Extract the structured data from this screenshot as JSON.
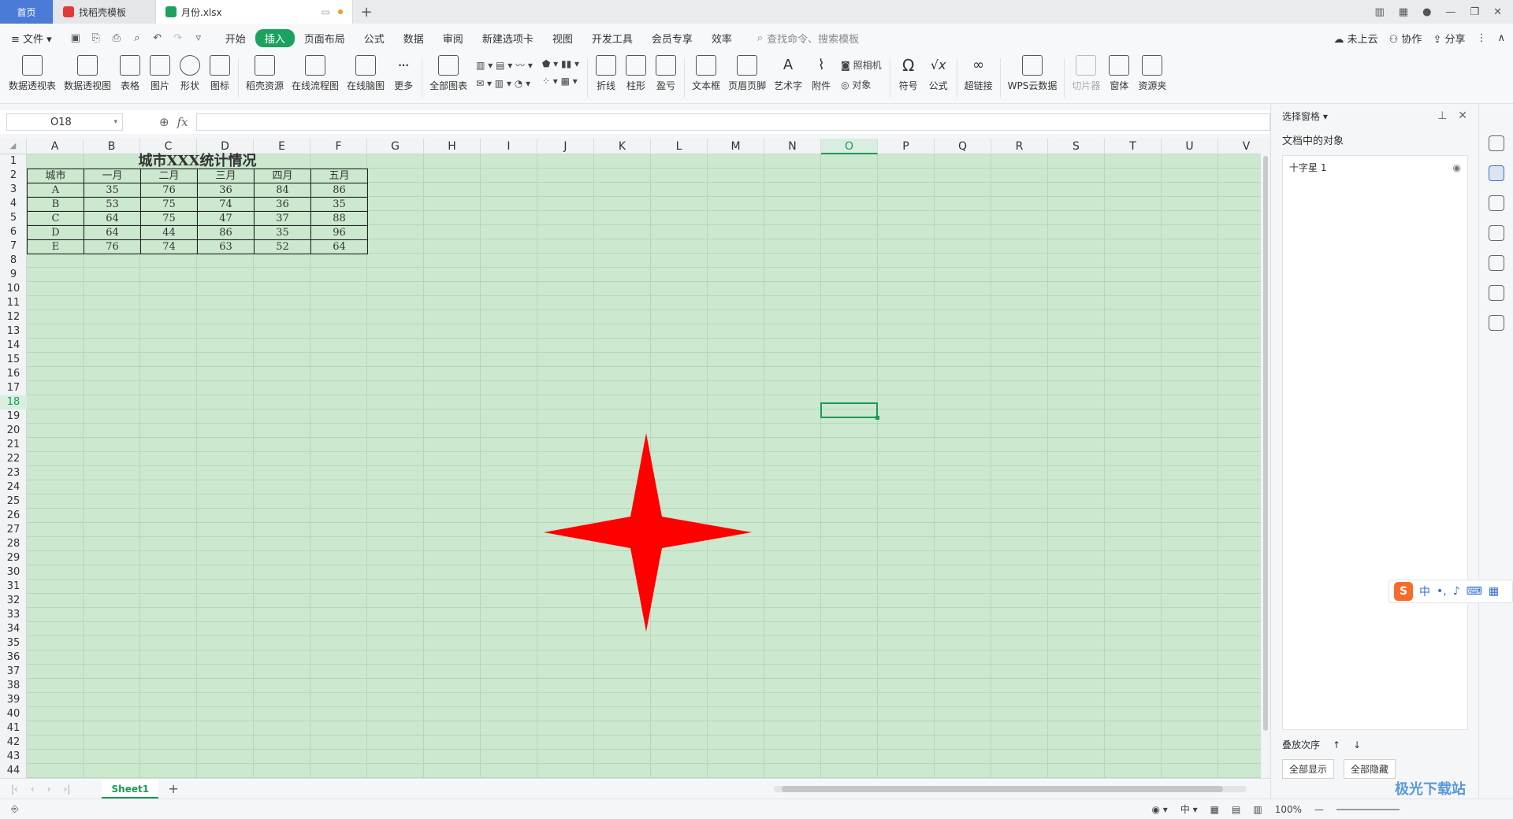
{
  "tabs": {
    "home": "首页",
    "daoke": "找稻壳模板",
    "file": "月份.xlsx"
  },
  "menu": {
    "file": "文件",
    "items": [
      "开始",
      "插入",
      "页面布局",
      "公式",
      "数据",
      "审阅",
      "新建选项卡",
      "视图",
      "开发工具",
      "会员专享",
      "效率"
    ],
    "active_index": 1,
    "search_placeholder": "查找命令、搜索模板",
    "right": [
      "未上云",
      "协作",
      "分享"
    ]
  },
  "ribbon": {
    "large": [
      "数据透视表",
      "数据透视图",
      "表格",
      "图片",
      "形状",
      "图标",
      "稻壳资源",
      "在线流程图",
      "在线脑图",
      "更多",
      "全部图表"
    ],
    "chart_large": [
      "折线",
      "柱形",
      "盈亏",
      "文本框",
      "页眉页脚",
      "艺术字",
      "附件"
    ],
    "camera": "照相机",
    "object": "对象",
    "tail": [
      "符号",
      "公式",
      "超链接",
      "WPS云数据",
      "切片器",
      "窗体",
      "资源夹"
    ]
  },
  "formula": {
    "namebox": "O18",
    "fx": "fx"
  },
  "columns": [
    "A",
    "B",
    "C",
    "D",
    "E",
    "F",
    "G",
    "H",
    "I",
    "J",
    "K",
    "L",
    "M",
    "N",
    "O",
    "P",
    "Q",
    "R",
    "S",
    "T",
    "U",
    "V"
  ],
  "selected_column": "O",
  "selected_row": 18,
  "row_count": 44,
  "table": {
    "title": "城市XXX统计情况",
    "headers": [
      "城市",
      "一月",
      "二月",
      "三月",
      "四月",
      "五月"
    ],
    "rows": [
      [
        "A",
        "35",
        "76",
        "36",
        "84",
        "86"
      ],
      [
        "B",
        "53",
        "75",
        "74",
        "36",
        "35"
      ],
      [
        "C",
        "64",
        "75",
        "47",
        "37",
        "88"
      ],
      [
        "D",
        "64",
        "44",
        "86",
        "35",
        "96"
      ],
      [
        "E",
        "76",
        "74",
        "63",
        "52",
        "64"
      ]
    ]
  },
  "shape": {
    "type": "four-point-star",
    "color": "#ff0000"
  },
  "sheet": {
    "name": "Sheet1"
  },
  "status": {
    "zoom": "100%"
  },
  "pane": {
    "title": "选择窗格",
    "subtitle": "文档中的对象",
    "objects": [
      "十字星 1"
    ],
    "order_label": "叠放次序",
    "show_all": "全部显示",
    "hide_all": "全部隐藏"
  },
  "ime": {
    "lang": "中"
  },
  "watermark": "极光下载站",
  "colors": {
    "accent": "#1ba260",
    "grid_bg": "#cce8cf",
    "home_tab": "#4a7bd6"
  }
}
